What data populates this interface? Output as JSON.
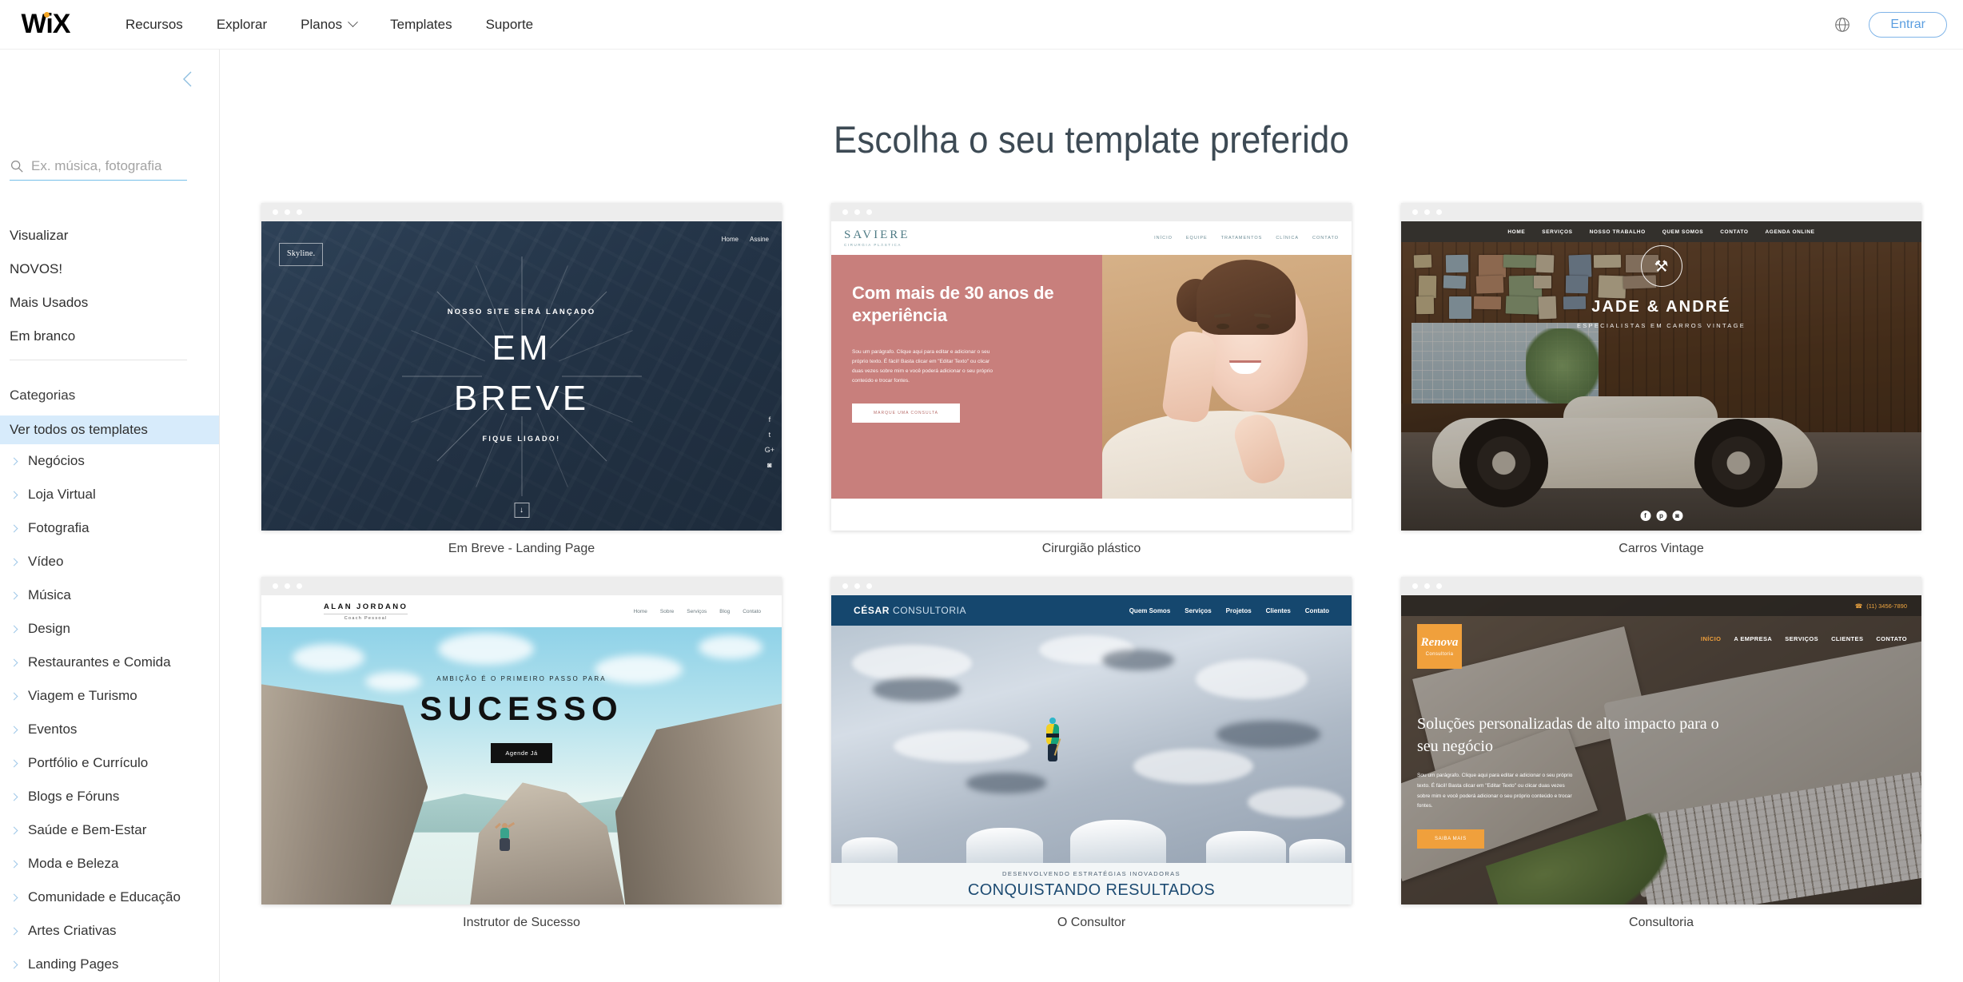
{
  "topbar": {
    "logo": "WiX",
    "nav": [
      {
        "label": "Recursos",
        "has_caret": false
      },
      {
        "label": "Explorar",
        "has_caret": false
      },
      {
        "label": "Planos",
        "has_caret": true
      },
      {
        "label": "Templates",
        "has_caret": false
      },
      {
        "label": "Suporte",
        "has_caret": false
      }
    ],
    "language_icon": "globe-icon",
    "login_label": "Entrar",
    "login_color": "#5b9ee0"
  },
  "sidebar": {
    "collapse_icon": "chevron-left-icon",
    "search": {
      "placeholder": "Ex. música, fotografia",
      "value": "",
      "icon": "search-icon"
    },
    "quick_links": [
      "Visualizar",
      "NOVOS!",
      "Mais Usados",
      "Em branco"
    ],
    "categories_title": "Categorias",
    "all_templates": "Ver todos os templates",
    "all_templates_selected": true,
    "highlight_color": "#d7ebfb",
    "categories": [
      "Negócios",
      "Loja Virtual",
      "Fotografia",
      "Vídeo",
      "Música",
      "Design",
      "Restaurantes e Comida",
      "Viagem e Turismo",
      "Eventos",
      "Portfólio e Currículo",
      "Blogs e Fóruns",
      "Saúde e Bem-Estar",
      "Moda e Beleza",
      "Comunidade e Educação",
      "Artes Criativas",
      "Landing Pages"
    ]
  },
  "main": {
    "page_title": "Escolha o seu template preferido",
    "templates": [
      {
        "caption": "Em Breve - Landing Page",
        "preview": {
          "brand": "Skyline.",
          "nav": [
            "Home",
            "Assine"
          ],
          "kicker": "NOSSO SITE SERÁ LANÇADO",
          "headline_line1": "EM",
          "headline_line2": "BREVE",
          "subline": "FIQUE LIGADO!",
          "social": [
            "f",
            "t",
            "G+",
            "◙"
          ],
          "scroll_icon": "↓"
        }
      },
      {
        "caption": "Cirurgião plástico",
        "preview": {
          "brand": "SAVIERE",
          "brand_sub": "CIRURGIA PLÁSTICA",
          "nav": [
            "INÍCIO",
            "EQUIPE",
            "TRATAMENTOS",
            "CLÍNICA",
            "CONTATO"
          ],
          "headline": "Com mais de 30 anos de experiência",
          "paragraph": "Sou um parágrafo. Clique aqui para editar e adicionar o seu próprio texto. É fácil! Basta clicar em \"Editar Texto\" ou clicar duas vezes sobre mim e você poderá adicionar o seu próprio conteúdo e trocar fontes.",
          "cta": "MARQUE UMA CONSULTA",
          "accent": "#c87f7c"
        }
      },
      {
        "caption": "Carros Vintage",
        "preview": {
          "nav": [
            "HOME",
            "SERVIÇOS",
            "NOSSO TRABALHO",
            "QUEM SOMOS",
            "CONTATO",
            "AGENDA ONLINE"
          ],
          "badge_icon": "crossed-wrenches-icon",
          "title": "JADE & ANDRÉ",
          "subtitle": "ESPECIALISTAS EM CARROS VINTAGE",
          "social": [
            "f",
            "p",
            "◙"
          ]
        }
      },
      {
        "caption": "Instrutor de Sucesso",
        "preview": {
          "brand": "ALAN JORDANO",
          "brand_sub": "Coach Pessoal",
          "nav": [
            "Home",
            "Sobre",
            "Serviços",
            "Blog",
            "Contato"
          ],
          "kicker": "AMBIÇÃO É O PRIMEIRO PASSO PARA",
          "headline": "SUCESSO",
          "cta": "Agende Já"
        }
      },
      {
        "caption": "O Consultor",
        "preview": {
          "brand": "CÉSAR",
          "brand_light": "CONSULTORIA",
          "nav": [
            "Quem Somos",
            "Serviços",
            "Projetos",
            "Clientes",
            "Contato"
          ],
          "kicker": "DESENVOLVENDO ESTRATÉGIAS INOVADORAS",
          "headline": "CONQUISTANDO RESULTADOS",
          "accent": "#15476e"
        }
      },
      {
        "caption": "Consultoria",
        "preview": {
          "phone": "(11) 3456-7890",
          "phone_icon": "phone-icon",
          "brand": "Renova",
          "brand_sub": "Consultoria",
          "nav": [
            "INÍCIO",
            "A EMPRESA",
            "SERVIÇOS",
            "CLIENTES",
            "CONTATO"
          ],
          "nav_active": "INÍCIO",
          "headline": "Soluções personalizadas de alto impacto para o seu negócio",
          "paragraph": "Sou um parágrafo. Clique aqui para editar e adicionar o seu próprio texto. É fácil! Basta clicar em \"Editar Texto\" ou clicar duas vezes sobre mim e você poderá adicionar o seu próprio conteúdo e trocar fontes.",
          "cta": "SAIBA MAIS",
          "accent": "#f0a03c"
        }
      }
    ]
  }
}
